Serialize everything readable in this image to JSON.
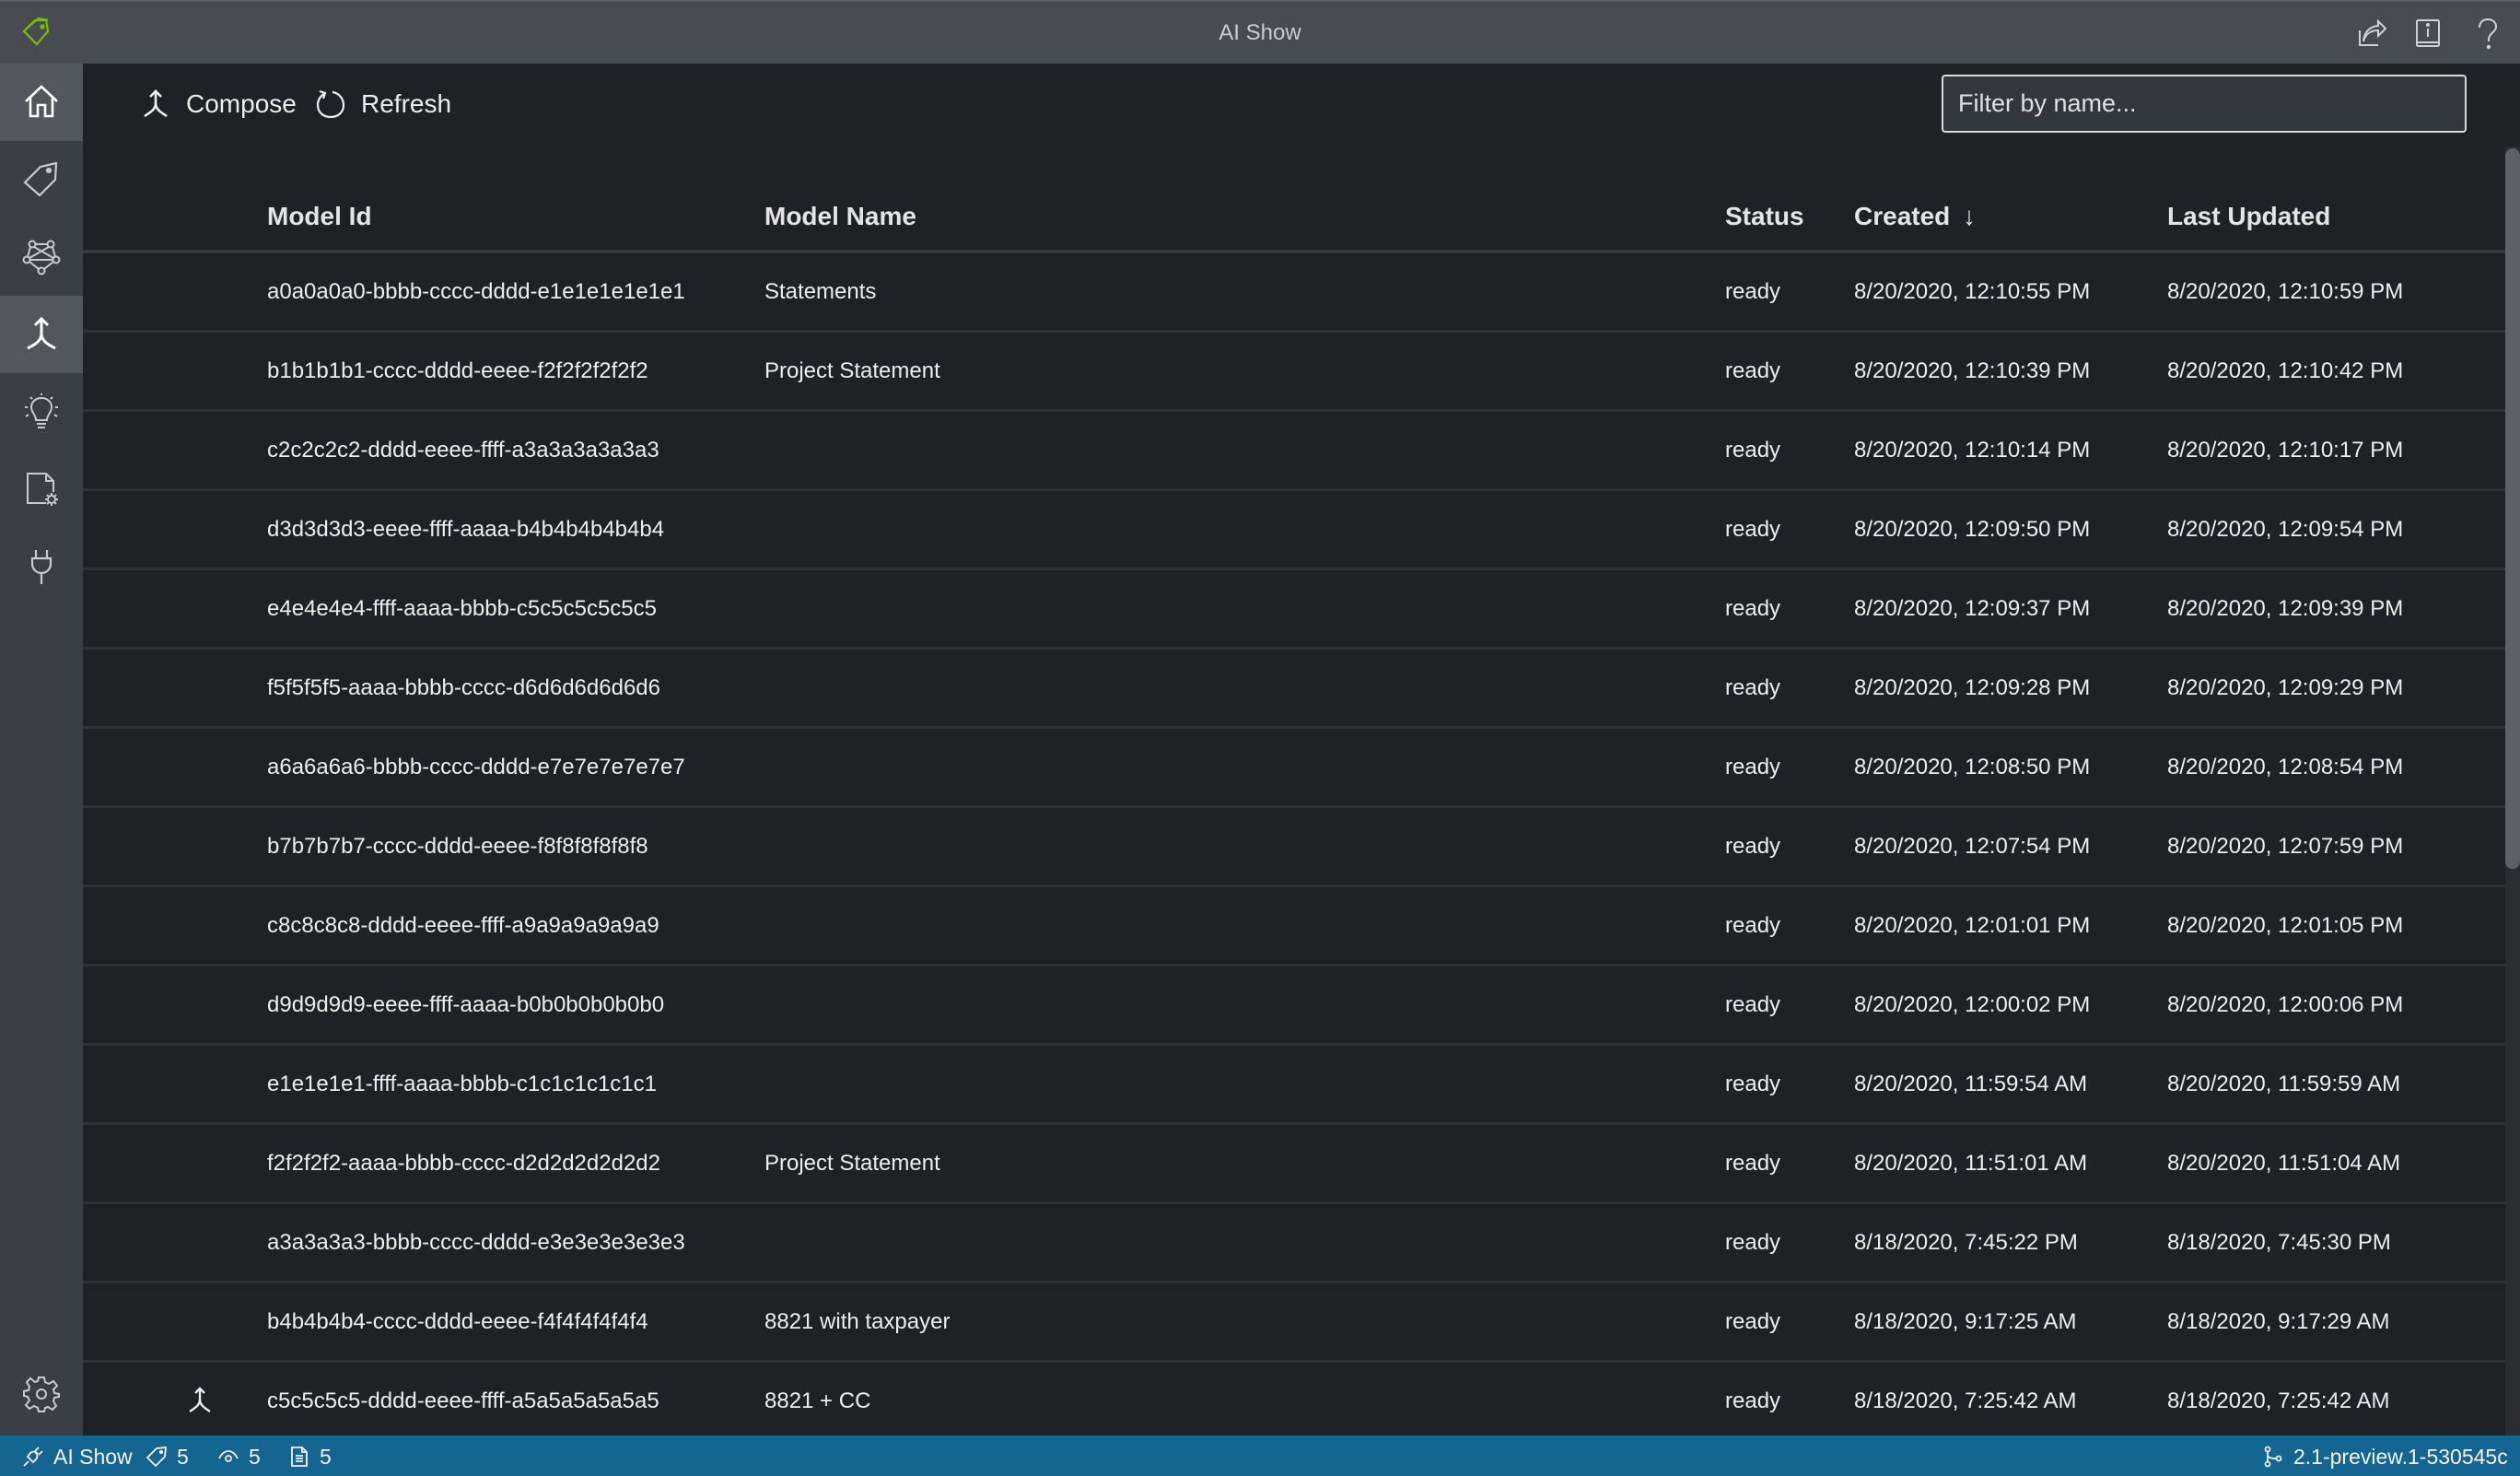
{
  "app": {
    "title": "AI Show",
    "brand_color": "#7cbb00",
    "statusbar_color": "#14658f"
  },
  "titlebar_icons": [
    {
      "name": "share-icon"
    },
    {
      "name": "guide-book-icon"
    },
    {
      "name": "help-icon"
    }
  ],
  "sidebar": {
    "items": [
      {
        "name": "home",
        "icon": "home-icon",
        "active": true
      },
      {
        "name": "tags",
        "icon": "tag-icon",
        "active": false
      },
      {
        "name": "train",
        "icon": "network-icon",
        "active": false
      },
      {
        "name": "compose",
        "icon": "merge-icon",
        "active": true
      },
      {
        "name": "analyze",
        "icon": "lightbulb-icon",
        "active": false
      },
      {
        "name": "ocr-settings",
        "icon": "document-gear-icon",
        "active": false
      },
      {
        "name": "connections",
        "icon": "plug-icon",
        "active": false
      }
    ],
    "settings": {
      "name": "settings",
      "icon": "gear-icon"
    }
  },
  "toolbar": {
    "compose_label": "Compose",
    "refresh_label": "Refresh"
  },
  "filter": {
    "placeholder": "Filter by name...",
    "value": ""
  },
  "table": {
    "columns": {
      "model_id": "Model Id",
      "model_name": "Model Name",
      "status": "Status",
      "created": "Created",
      "created_sort_indicator": "↓",
      "last_updated": "Last Updated"
    },
    "rows": [
      {
        "model_id": "a0a0a0a0-bbbb-cccc-dddd-e1e1e1e1e1e1",
        "model_name": "Statements",
        "status": "ready",
        "created": "8/20/2020, 12:10:55 PM",
        "last_updated": "8/20/2020, 12:10:59 PM",
        "composed": false
      },
      {
        "model_id": "b1b1b1b1-cccc-dddd-eeee-f2f2f2f2f2f2",
        "model_name": "Project Statement",
        "status": "ready",
        "created": "8/20/2020, 12:10:39 PM",
        "last_updated": "8/20/2020, 12:10:42 PM",
        "composed": false
      },
      {
        "model_id": "c2c2c2c2-dddd-eeee-ffff-a3a3a3a3a3a3",
        "model_name": "",
        "status": "ready",
        "created": "8/20/2020, 12:10:14 PM",
        "last_updated": "8/20/2020, 12:10:17 PM",
        "composed": false
      },
      {
        "model_id": "d3d3d3d3-eeee-ffff-aaaa-b4b4b4b4b4b4",
        "model_name": "",
        "status": "ready",
        "created": "8/20/2020, 12:09:50 PM",
        "last_updated": "8/20/2020, 12:09:54 PM",
        "composed": false
      },
      {
        "model_id": "e4e4e4e4-ffff-aaaa-bbbb-c5c5c5c5c5c5",
        "model_name": "",
        "status": "ready",
        "created": "8/20/2020, 12:09:37 PM",
        "last_updated": "8/20/2020, 12:09:39 PM",
        "composed": false
      },
      {
        "model_id": "f5f5f5f5-aaaa-bbbb-cccc-d6d6d6d6d6d6",
        "model_name": "",
        "status": "ready",
        "created": "8/20/2020, 12:09:28 PM",
        "last_updated": "8/20/2020, 12:09:29 PM",
        "composed": false
      },
      {
        "model_id": "a6a6a6a6-bbbb-cccc-dddd-e7e7e7e7e7e7",
        "model_name": "",
        "status": "ready",
        "created": "8/20/2020, 12:08:50 PM",
        "last_updated": "8/20/2020, 12:08:54 PM",
        "composed": false
      },
      {
        "model_id": "b7b7b7b7-cccc-dddd-eeee-f8f8f8f8f8f8",
        "model_name": "",
        "status": "ready",
        "created": "8/20/2020, 12:07:54 PM",
        "last_updated": "8/20/2020, 12:07:59 PM",
        "composed": false
      },
      {
        "model_id": "c8c8c8c8-dddd-eeee-ffff-a9a9a9a9a9a9",
        "model_name": "",
        "status": "ready",
        "created": "8/20/2020, 12:01:01 PM",
        "last_updated": "8/20/2020, 12:01:05 PM",
        "composed": false
      },
      {
        "model_id": "d9d9d9d9-eeee-ffff-aaaa-b0b0b0b0b0b0",
        "model_name": "",
        "status": "ready",
        "created": "8/20/2020, 12:00:02 PM",
        "last_updated": "8/20/2020, 12:00:06 PM",
        "composed": false
      },
      {
        "model_id": "e1e1e1e1-ffff-aaaa-bbbb-c1c1c1c1c1c1",
        "model_name": "",
        "status": "ready",
        "created": "8/20/2020, 11:59:54 AM",
        "last_updated": "8/20/2020, 11:59:59 AM",
        "composed": false
      },
      {
        "model_id": "f2f2f2f2-aaaa-bbbb-cccc-d2d2d2d2d2d2",
        "model_name": "Project Statement",
        "status": "ready",
        "created": "8/20/2020, 11:51:01 AM",
        "last_updated": "8/20/2020, 11:51:04 AM",
        "composed": false
      },
      {
        "model_id": "a3a3a3a3-bbbb-cccc-dddd-e3e3e3e3e3e3",
        "model_name": "",
        "status": "ready",
        "created": "8/18/2020, 7:45:22 PM",
        "last_updated": "8/18/2020, 7:45:30 PM",
        "composed": false
      },
      {
        "model_id": "b4b4b4b4-cccc-dddd-eeee-f4f4f4f4f4f4",
        "model_name": "8821 with taxpayer",
        "status": "ready",
        "created": "8/18/2020, 9:17:25 AM",
        "last_updated": "8/18/2020, 9:17:29 AM",
        "composed": false
      },
      {
        "model_id": "c5c5c5c5-dddd-eeee-ffff-a5a5a5a5a5a5",
        "model_name": "8821 + CC",
        "status": "ready",
        "created": "8/18/2020, 7:25:42 AM",
        "last_updated": "8/18/2020, 7:25:42 AM",
        "composed": true
      }
    ]
  },
  "statusbar": {
    "project_name": "AI Show",
    "tag_count": "5",
    "visited_count": "5",
    "asset_count": "5",
    "version": "2.1-preview.1-530545c"
  }
}
